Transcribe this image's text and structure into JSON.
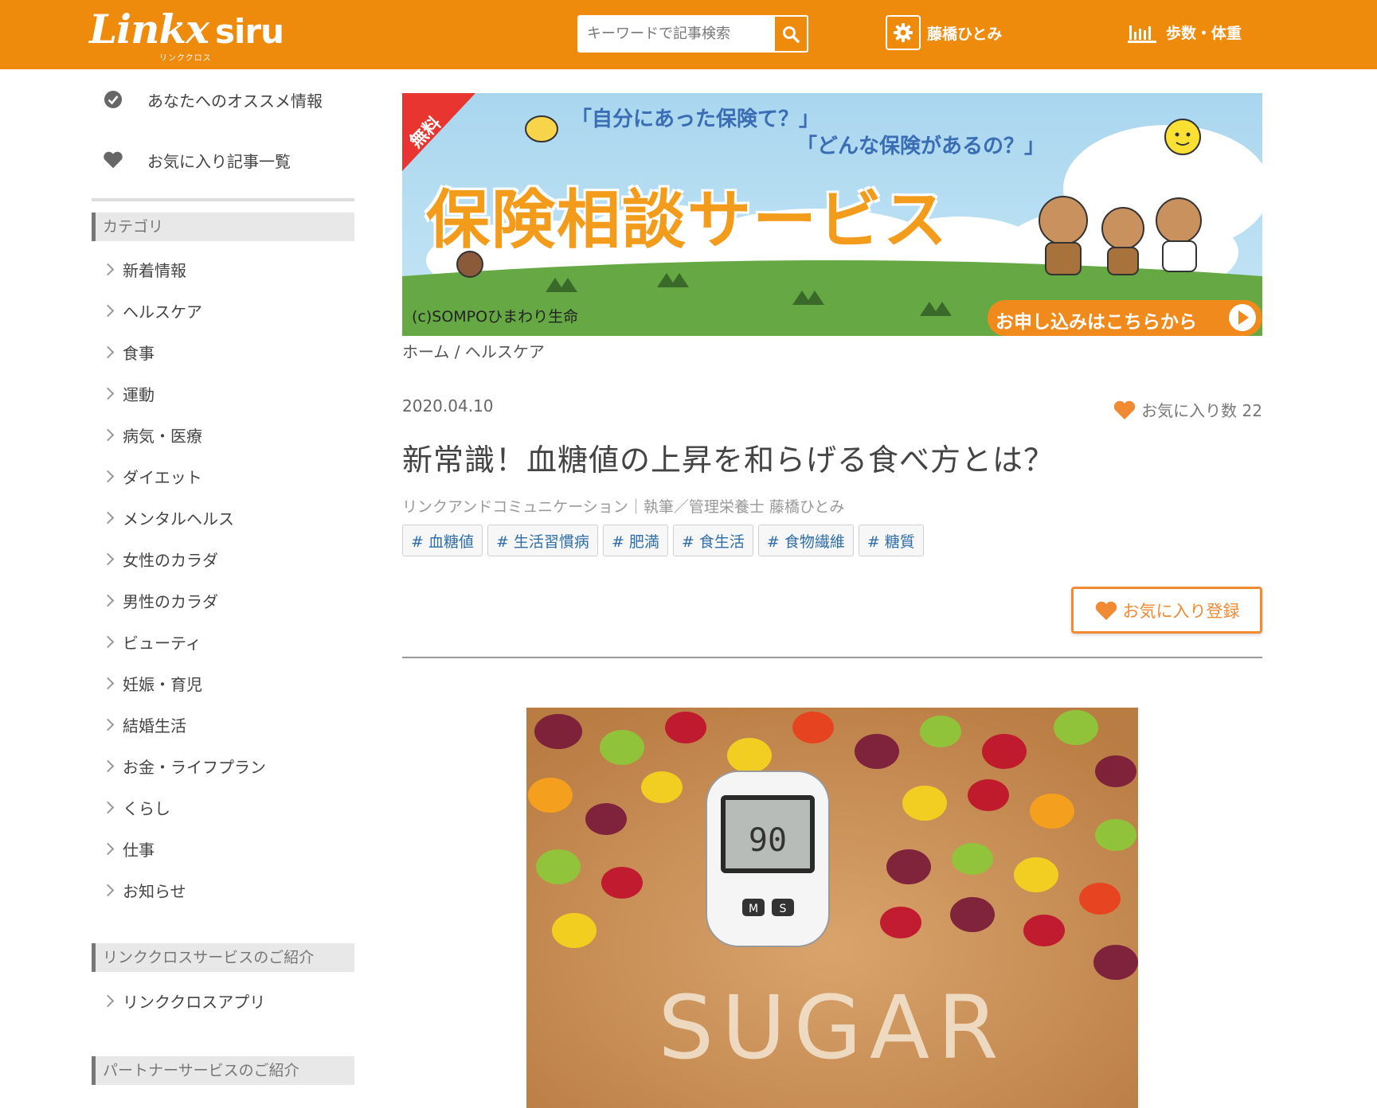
{
  "header": {
    "logo_main": "Linkx",
    "logo_siru": "siru",
    "logo_sub": "リンククロス",
    "search_placeholder": "キーワードで記事検索",
    "user_name": "藤橋ひとみ",
    "steps_label": "歩数・体重"
  },
  "sidebar": {
    "top_items": [
      {
        "label": "あなたへのオススメ情報",
        "icon": "check-circle-icon"
      },
      {
        "label": "お気に入り記事一覧",
        "icon": "heart-icon"
      }
    ],
    "category_heading": "カテゴリ",
    "categories": [
      "新着情報",
      "ヘルスケア",
      "食事",
      "運動",
      "病気・医療",
      "ダイエット",
      "メンタルヘルス",
      "女性のカラダ",
      "男性のカラダ",
      "ビューティ",
      "妊娠・育児",
      "結婚生活",
      "お金・ライフプラン",
      "くらし",
      "仕事",
      "お知らせ"
    ],
    "service_heading": "リンククロスサービスのご紹介",
    "services": [
      "リンククロスアプリ"
    ],
    "partner_heading": "パートナーサービスのご紹介"
  },
  "banner": {
    "badge": "無料",
    "question1": "「自分にあった保険て？」",
    "question2": "「どんな保険があるの？」",
    "headline": "保険相談サービス",
    "copyright": "(c)SOMPOひまわり生命",
    "cta": "お申し込みはこちらから",
    "colors": {
      "sky": "#a9d6ef",
      "grass": "#66a844",
      "headline": "#f39b1b",
      "cta": "#f08a1c",
      "badge": "#e8352f"
    }
  },
  "article": {
    "breadcrumb": "ホーム / ヘルスケア",
    "date": "2020.04.10",
    "favorite_count_label": "お気に入り数 22",
    "title": "新常識！血糖値の上昇を和らげる食べ方とは？",
    "author": "リンクアンドコミュニケーション｜執筆／管理栄養士 藤橋ひとみ",
    "tags": [
      "# 血糖値",
      "# 生活習慣病",
      "# 肥満",
      "# 食生活",
      "# 食物繊維",
      "# 糖質"
    ],
    "favorite_button": "お気に入り登録",
    "hero": {
      "meter_reading": "90",
      "buttons": [
        "M",
        "S"
      ],
      "sand_text": "SUGAR"
    }
  },
  "colors": {
    "brand": "#ee8a0c",
    "accent": "#f08a33",
    "tag_text": "#2f6ea8"
  }
}
